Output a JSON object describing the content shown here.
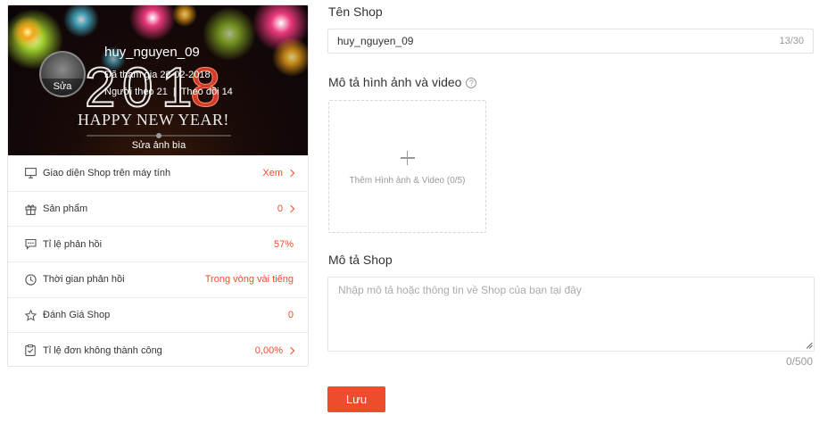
{
  "profile": {
    "username": "huy_nguyen_09",
    "joined": "Đã tham gia 22-02-2018",
    "followers": "Người theo 21",
    "separator": "|",
    "following": "Theo dõi 14",
    "avatar_edit": "Sửa",
    "cover_edit": "Sửa ảnh bìa",
    "cover_year": "2018",
    "cover_greeting": "HAPPY NEW YEAR!"
  },
  "stats": [
    {
      "icon": "desktop-icon",
      "label": "Giao diện Shop trên máy tính",
      "value": "Xem",
      "chevron": true
    },
    {
      "icon": "gift-icon",
      "label": "Sản phẩm",
      "value": "0",
      "chevron": true
    },
    {
      "icon": "chat-icon",
      "label": "Tỉ lệ phản hồi",
      "value": "57%",
      "chevron": false
    },
    {
      "icon": "clock-icon",
      "label": "Thời gian phản hồi",
      "value": "Trong vòng vài tiếng",
      "chevron": false
    },
    {
      "icon": "star-icon",
      "label": "Đánh Giá Shop",
      "value": "0",
      "chevron": false
    },
    {
      "icon": "clipboard-icon",
      "label": "Tỉ lệ đơn không thành công",
      "value": "0,00%",
      "chevron": true
    }
  ],
  "form": {
    "shop_name_label": "Tên Shop",
    "shop_name_value": "huy_nguyen_09",
    "shop_name_counter": "13/30",
    "media_label": "Mô tả hình ảnh và video",
    "media_help": "?",
    "media_add": "Thêm Hình ảnh & Video (0/5)",
    "description_label": "Mô tả Shop",
    "description_placeholder": "Nhập mô tả hoặc thông tin về Shop của bạn tại đây",
    "description_counter": "0/500",
    "save_label": "Lưu"
  },
  "colors": {
    "accent": "#ee4d2d",
    "border": "#e2e2e2"
  }
}
